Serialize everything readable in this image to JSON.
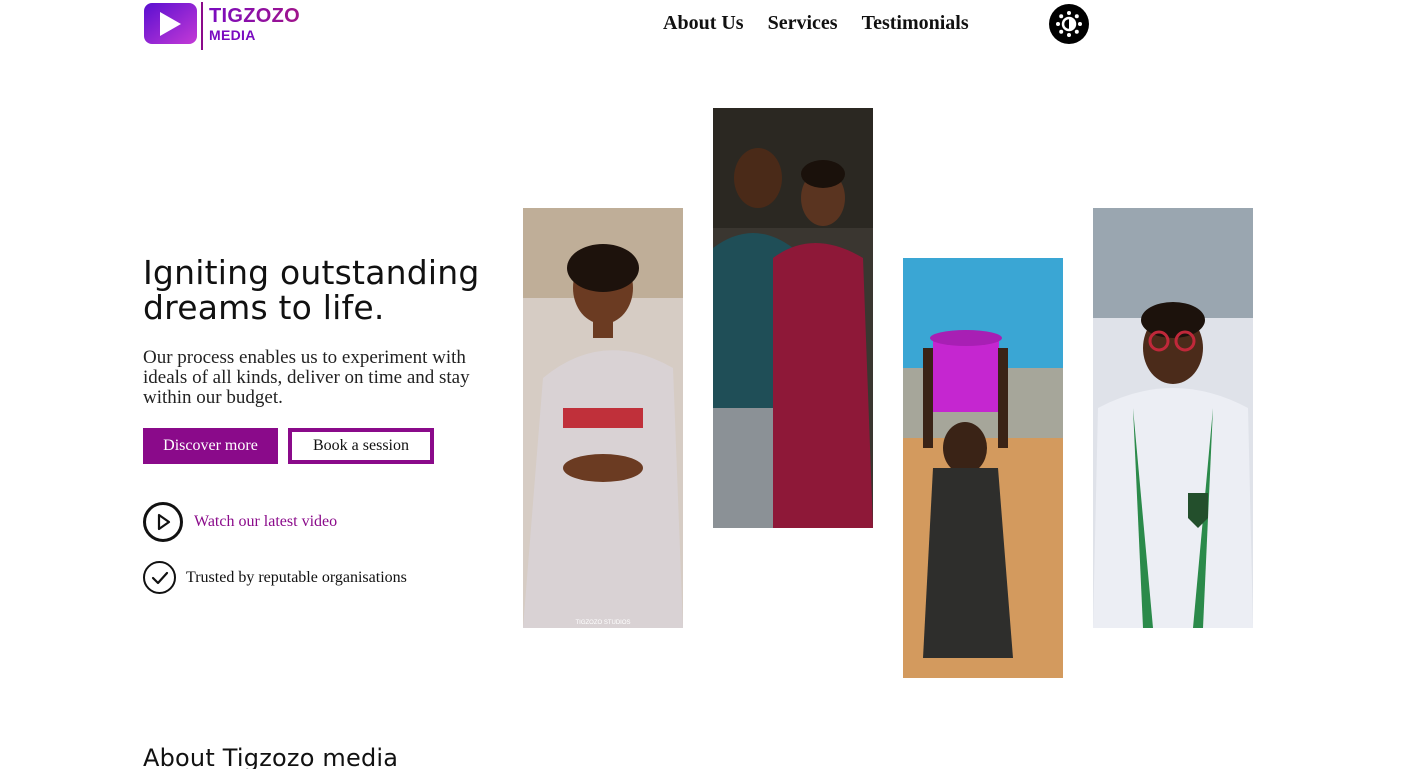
{
  "brand": {
    "name_line1": "TIGZOZO",
    "name_line2": "MEDIA",
    "colors": {
      "primary": "#8a0a8a",
      "logo_gradient_start": "#7a0bc0",
      "logo_gradient_end": "#c43ad6"
    }
  },
  "nav": {
    "items": [
      {
        "label": "About Us"
      },
      {
        "label": "Services"
      },
      {
        "label": "Testimonials"
      }
    ],
    "theme_toggle_icon": "sun-icon"
  },
  "hero": {
    "title": "Igniting outstanding dreams to life.",
    "subtitle": "Our process enables us to experiment with ideals of all kinds, deliver on time and stay within our budget.",
    "primary_button": "Discover more",
    "secondary_button": "Book a session",
    "video_link": "Watch our latest video",
    "trusted_text": "Trusted by reputable organisations",
    "photos": [
      {
        "icon": "photo-bride"
      },
      {
        "icon": "photo-couple"
      },
      {
        "icon": "photo-child-bucket"
      },
      {
        "icon": "photo-student"
      }
    ],
    "photo_watermark": "TIGZOZO STUDIOS"
  },
  "about": {
    "title": "About Tigzozo media"
  }
}
